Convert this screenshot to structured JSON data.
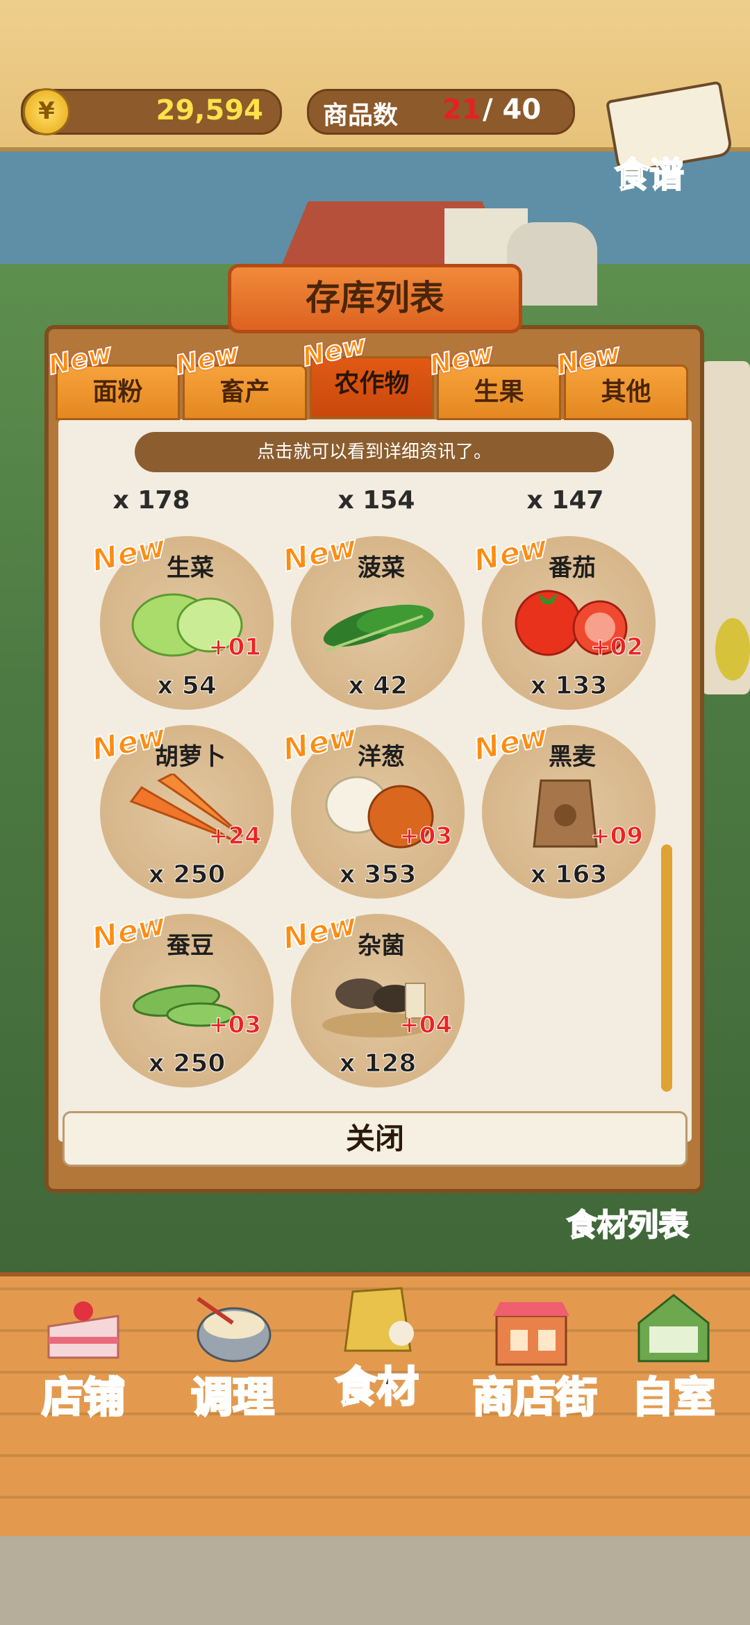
{
  "topbar": {
    "coin_symbol": "¥",
    "coins": "29,594",
    "goods_label": "商品数",
    "goods_current": "21",
    "goods_sep": "/",
    "goods_max": "40",
    "recipe_label": "食谱"
  },
  "panel": {
    "title": "存库列表",
    "tabs": [
      {
        "label": "面粉",
        "badge": "New"
      },
      {
        "label": "畜产",
        "badge": "New"
      },
      {
        "label": "农作物",
        "badge": "New"
      },
      {
        "label": "生果",
        "badge": "New"
      },
      {
        "label": "其他",
        "badge": "New"
      }
    ],
    "hint": "点击就可以看到详细资讯了。",
    "prev_counts": [
      "x 178",
      "x 154",
      "x 147"
    ],
    "items": [
      {
        "name": "生菜",
        "badge": "New",
        "plus": "+01",
        "count": "x 54",
        "icon": "lettuce-icon"
      },
      {
        "name": "菠菜",
        "badge": "New",
        "plus": "",
        "count": "x 42",
        "icon": "spinach-icon"
      },
      {
        "name": "番茄",
        "badge": "New",
        "plus": "+02",
        "count": "x 133",
        "icon": "tomato-icon"
      },
      {
        "name": "胡萝卜",
        "badge": "New",
        "plus": "+24",
        "count": "x 250",
        "icon": "carrot-icon"
      },
      {
        "name": "洋葱",
        "badge": "New",
        "plus": "+03",
        "count": "x 353",
        "icon": "onion-icon"
      },
      {
        "name": "黑麦",
        "badge": "New",
        "plus": "+09",
        "count": "x 163",
        "icon": "rye-sack-icon"
      },
      {
        "name": "蚕豆",
        "badge": "New",
        "plus": "+03",
        "count": "x 250",
        "icon": "bean-icon"
      },
      {
        "name": "杂菌",
        "badge": "New",
        "plus": "+04",
        "count": "x 128",
        "icon": "mushroom-icon"
      }
    ],
    "close_label": "关闭"
  },
  "food_list_label": "食材列表",
  "nav": [
    {
      "label": "店铺",
      "icon": "cake-icon"
    },
    {
      "label": "调理",
      "icon": "mixing-bowl-icon"
    },
    {
      "label": "食材",
      "icon": "flour-sack-icon"
    },
    {
      "label": "商店街",
      "icon": "shop-icon"
    },
    {
      "label": "自室",
      "icon": "staff-only-sign-icon"
    }
  ],
  "colors": {
    "accent_orange": "#e48820",
    "active_tab": "#c9480c",
    "coin_text": "#ffe14a",
    "plus_red": "#e22222"
  }
}
